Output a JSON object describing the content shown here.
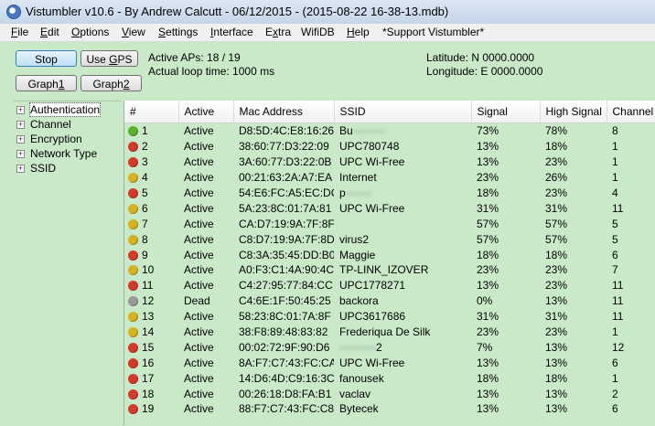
{
  "window": {
    "title": "Vistumbler v10.6 - By Andrew Calcutt - 06/12/2015 - (2015-08-22 16-38-13.mdb)"
  },
  "menu": [
    {
      "pre": "",
      "u": "F",
      "post": "ile"
    },
    {
      "pre": "",
      "u": "E",
      "post": "dit"
    },
    {
      "pre": "",
      "u": "O",
      "post": "ptions"
    },
    {
      "pre": "",
      "u": "V",
      "post": "iew"
    },
    {
      "pre": "",
      "u": "S",
      "post": "ettings"
    },
    {
      "pre": "",
      "u": "I",
      "post": "nterface"
    },
    {
      "pre": "E",
      "u": "x",
      "post": "tra"
    },
    {
      "pre": "WifiDB",
      "u": "",
      "post": ""
    },
    {
      "pre": "",
      "u": "H",
      "post": "elp"
    },
    {
      "pre": "*Support Vistumbler*",
      "u": "",
      "post": ""
    }
  ],
  "controls": {
    "stop_label": "Stop",
    "use_gps": {
      "pre": "Use ",
      "u": "G",
      "post": "PS"
    },
    "graph1": {
      "pre": "Graph",
      "u": "1",
      "post": ""
    },
    "graph2": {
      "pre": "Graph",
      "u": "2",
      "post": ""
    },
    "active_aps": "Active APs: 18 / 19",
    "loop_time": "Actual loop time: 1000 ms",
    "latitude": "Latitude: N 0000.0000",
    "longitude": "Longitude: E 0000.0000"
  },
  "sidebar": {
    "items": [
      "Authentication",
      "Channel",
      "Encryption",
      "Network Type",
      "SSID"
    ]
  },
  "colors": {
    "green": "#5cb030",
    "yellow": "#d8b120",
    "red": "#d23a2a",
    "gray": "#9a9a9a"
  },
  "table": {
    "columns": [
      "#",
      "Active",
      "Mac Address",
      "SSID",
      "Signal",
      "High Signal",
      "Channel"
    ],
    "rows": [
      {
        "num": "1",
        "active": "Active",
        "mac": "D8:5D:4C:E8:16:26",
        "ssid": "Bu",
        "ssid_blur": "·········",
        "signal": "73%",
        "high": "78%",
        "channel": "8",
        "color": "green"
      },
      {
        "num": "2",
        "active": "Active",
        "mac": "38:60:77:D3:22:09",
        "ssid": "UPC780748",
        "signal": "13%",
        "high": "18%",
        "channel": "1",
        "color": "red"
      },
      {
        "num": "3",
        "active": "Active",
        "mac": "3A:60:77:D3:22:0B",
        "ssid": "UPC Wi-Free",
        "signal": "13%",
        "high": "23%",
        "channel": "1",
        "color": "red"
      },
      {
        "num": "4",
        "active": "Active",
        "mac": "00:21:63:2A:A7:EA",
        "ssid": "Internet",
        "signal": "23%",
        "high": "26%",
        "channel": "1",
        "color": "yellow"
      },
      {
        "num": "5",
        "active": "Active",
        "mac": "54:E6:FC:A5:EC:DC",
        "ssid": "p",
        "ssid_blur": "·······",
        "signal": "18%",
        "high": "23%",
        "channel": "4",
        "color": "red"
      },
      {
        "num": "6",
        "active": "Active",
        "mac": "5A:23:8C:01:7A:81",
        "ssid": "UPC Wi-Free",
        "signal": "31%",
        "high": "31%",
        "channel": "11",
        "color": "yellow"
      },
      {
        "num": "7",
        "active": "Active",
        "mac": "CA:D7:19:9A:7F:8F",
        "ssid": "",
        "signal": "57%",
        "high": "57%",
        "channel": "5",
        "color": "yellow"
      },
      {
        "num": "8",
        "active": "Active",
        "mac": "C8:D7:19:9A:7F:8D",
        "ssid": "virus2",
        "signal": "57%",
        "high": "57%",
        "channel": "5",
        "color": "yellow"
      },
      {
        "num": "9",
        "active": "Active",
        "mac": "C8:3A:35:45:DD:B0",
        "ssid": "Maggie",
        "signal": "18%",
        "high": "18%",
        "channel": "6",
        "color": "red"
      },
      {
        "num": "10",
        "active": "Active",
        "mac": "A0:F3:C1:4A:90:4C",
        "ssid": "TP-LINK_IZOVER",
        "signal": "23%",
        "high": "23%",
        "channel": "7",
        "color": "yellow"
      },
      {
        "num": "11",
        "active": "Active",
        "mac": "C4:27:95:77:84:CC",
        "ssid": "UPC1778271",
        "signal": "13%",
        "high": "23%",
        "channel": "11",
        "color": "red"
      },
      {
        "num": "12",
        "active": "Dead",
        "mac": "C4:6E:1F:50:45:25",
        "ssid": "backora",
        "signal": "0%",
        "high": "13%",
        "channel": "11",
        "color": "gray"
      },
      {
        "num": "13",
        "active": "Active",
        "mac": "58:23:8C:01:7A:8F",
        "ssid": "UPC3617686",
        "signal": "31%",
        "high": "31%",
        "channel": "11",
        "color": "yellow"
      },
      {
        "num": "14",
        "active": "Active",
        "mac": "38:F8:89:48:83:82",
        "ssid": "Frederiqua De Silk",
        "signal": "23%",
        "high": "23%",
        "channel": "1",
        "color": "yellow"
      },
      {
        "num": "15",
        "active": "Active",
        "mac": "00:02:72:9F:90:D6",
        "ssid": "2",
        "ssid_blur": "··········",
        "signal": "7%",
        "high": "13%",
        "channel": "12",
        "color": "red"
      },
      {
        "num": "16",
        "active": "Active",
        "mac": "8A:F7:C7:43:FC:CA",
        "ssid": "UPC Wi-Free",
        "signal": "13%",
        "high": "13%",
        "channel": "6",
        "color": "red"
      },
      {
        "num": "17",
        "active": "Active",
        "mac": "14:D6:4D:C9:16:3C",
        "ssid": "fanousek",
        "signal": "18%",
        "high": "18%",
        "channel": "1",
        "color": "red"
      },
      {
        "num": "18",
        "active": "Active",
        "mac": "00:26:18:D8:FA:B1",
        "ssid": "vaclav",
        "signal": "13%",
        "high": "13%",
        "channel": "2",
        "color": "red"
      },
      {
        "num": "19",
        "active": "Active",
        "mac": "88:F7:C7:43:FC:C8",
        "ssid": "Bytecek",
        "signal": "13%",
        "high": "13%",
        "channel": "6",
        "color": "red"
      }
    ]
  }
}
